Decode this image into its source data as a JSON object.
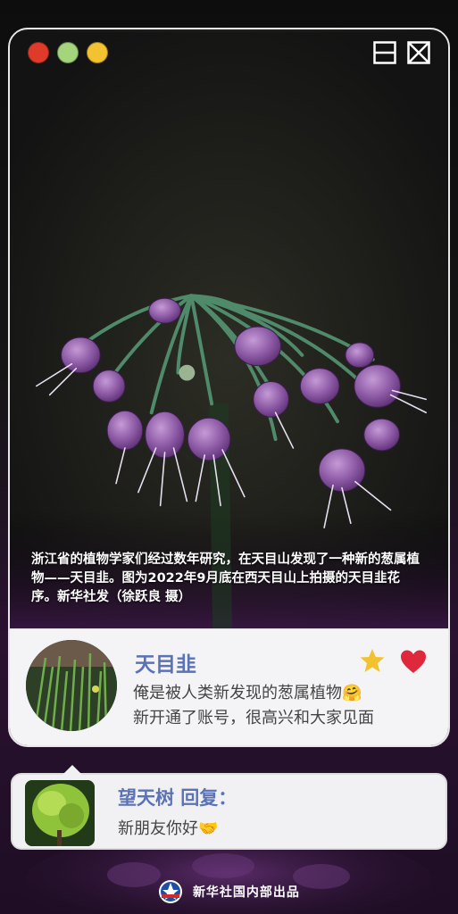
{
  "window": {
    "traffic_lights": [
      "close",
      "minimize",
      "zoom"
    ],
    "controls": [
      "minimize-box-icon",
      "close-box-icon"
    ]
  },
  "photo": {
    "caption": "浙江省的植物学家们经过数年研究，在天目山发现了一种新的葱属植物——天目韭。图为2022年9月底在西天目山上拍摄的天目韭花序。新华社发（徐跃良 摄）"
  },
  "profile": {
    "name": "天目韭",
    "message_line1": "俺是被人类新发现的葱属植物🤗",
    "message_line2": "新开通了账号，很高兴和大家见面"
  },
  "reply": {
    "name": "望天树 回复：",
    "message": "新朋友你好🤝"
  },
  "footer": {
    "text": "新华社国内部出品"
  },
  "colors": {
    "accent_blue": "#5b73b6",
    "star": "#f2c230",
    "heart": "#e0283c"
  }
}
